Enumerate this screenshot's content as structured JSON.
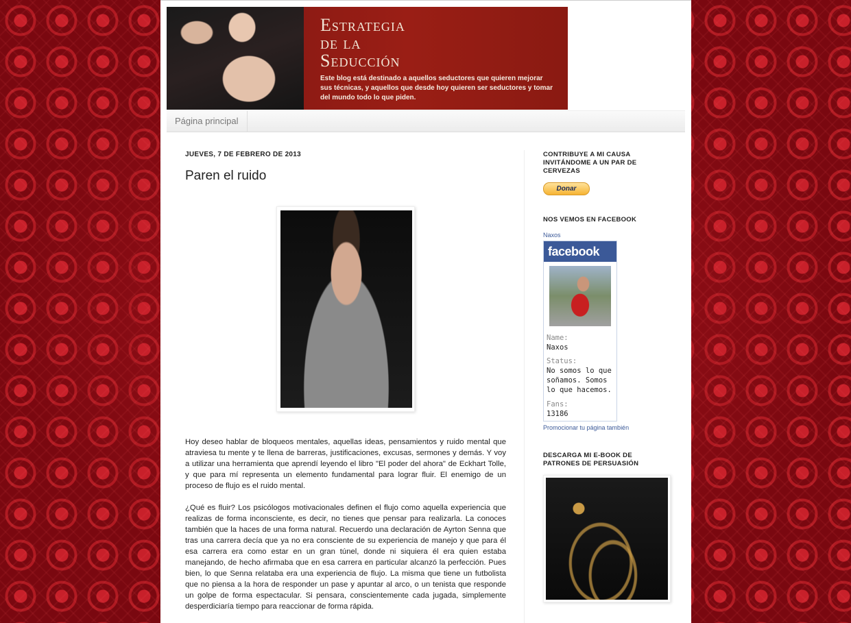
{
  "blog": {
    "title": "Estrategia\nde la\nSeducción",
    "description": "Este blog está destinado a aquellos seductores que quieren mejorar sus técnicas, y aquellos que desde hoy quieren ser seductores y tomar del mundo todo lo que piden."
  },
  "nav": {
    "home": "Página principal"
  },
  "post": {
    "date": "JUEVES, 7 DE FEBRERO DE 2013",
    "title": "Paren el ruido",
    "paragraphs": [
      "Hoy deseo hablar de bloqueos mentales, aquellas ideas, pensamientos y ruido mental que atraviesa tu mente y te llena de barreras, justificaciones, excusas, sermones y demás. Y voy a utilizar una herramienta que aprendí leyendo el libro \"El poder del ahora\" de Eckhart Tolle, y que para mí representa un elemento fundamental para lograr fluir. El enemigo de un proceso de flujo es el ruido mental.",
      "¿Qué es fluir? Los psicólogos motivacionales definen el flujo como aquella experiencia que realizas de forma inconsciente, es decir, no tienes que pensar para realizarla. La conoces también que la haces de una forma natural. Recuerdo una declaración de Ayrton Senna que tras una carrera decía que ya no era consciente de su experiencia de manejo y que para él esa carrera era como estar en un gran túnel, donde ni siquiera él era quien estaba manejando, de hecho afirmaba que en esa carrera en particular alcanzó la perfección. Pues bien, lo que Senna relataba era una experiencia de flujo. La misma que tiene un futbolista que no piensa a la hora de responder un pase y apuntar al arco, o un tenista que responde un golpe de forma espectacular. Si pensara, conscientemente cada jugada, simplemente desperdiciaría tiempo para reaccionar de forma rápida."
    ]
  },
  "sidebar": {
    "donate_title": "CONTRIBUYE A MI CAUSA INVITÁNDOME A UN PAR DE CERVEZAS",
    "donate_label": "Donar",
    "facebook_title": "NOS VEMOS EN FACEBOOK",
    "fb_link": "Naxos",
    "fb_logo": "facebook",
    "fb_name_label": "Name:",
    "fb_name": "Naxos",
    "fb_status_label": "Status:",
    "fb_status": "No somos lo que soñamos. Somos lo que hacemos.",
    "fb_fans_label": "Fans:",
    "fb_fans": "13186",
    "fb_promo": "Promocionar tu página también",
    "ebook_title": "DESCARGA MI E-BOOK DE PATRONES DE PERSUASIÓN"
  }
}
